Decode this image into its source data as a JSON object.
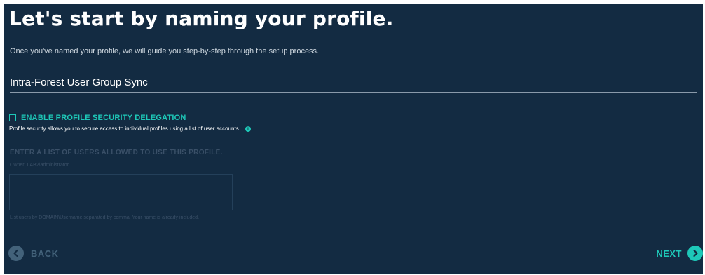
{
  "header": {
    "title": "Let's start by naming your profile.",
    "subtitle": "Once you've named your profile, we will guide you step-by-step through the setup process."
  },
  "profile_name": {
    "value": "Intra-Forest User Group Sync"
  },
  "security_delegation": {
    "checkbox_label": "ENABLE PROFILE SECURITY DELEGATION",
    "checked": false,
    "description": "Profile security allows you to secure access to individual profiles using a list of user accounts.",
    "info_icon": "info-icon"
  },
  "allowed_users": {
    "heading": "ENTER A LIST OF USERS ALLOWED TO USE THIS PROFILE.",
    "owner": "Owner: LAB2\\administrator",
    "value": "",
    "hint": "List users by DOMAIN\\Username separated by comma. Your name is already included."
  },
  "navigation": {
    "back_label": "BACK",
    "back_icon": "chevron-left-icon",
    "next_label": "NEXT",
    "next_icon": "chevron-right-icon"
  },
  "colors": {
    "background": "#132b42",
    "accent": "#1ec8b8",
    "text": "#ffffff",
    "disabled": "#3a5068"
  }
}
